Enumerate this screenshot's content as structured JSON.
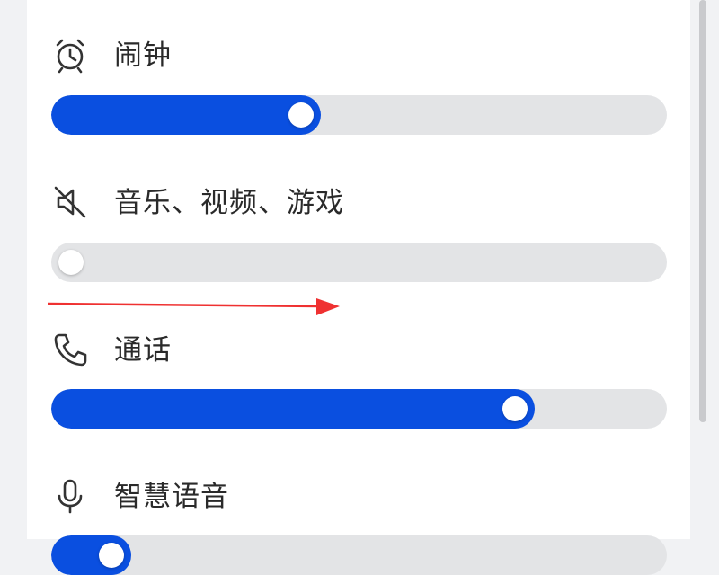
{
  "colors": {
    "accent": "#0a4fe0",
    "track": "#e3e4e6",
    "annotation_arrow": "#ef3131"
  },
  "volume_rows": [
    {
      "icon": "alarm-clock-icon",
      "label": "闹钟",
      "level": 0.4
    },
    {
      "icon": "speaker-muted-icon",
      "label": "音乐、视频、游戏",
      "level": 0.0
    },
    {
      "icon": "phone-icon",
      "label": "通话",
      "level": 0.77
    },
    {
      "icon": "microphone-icon",
      "label": "智慧语音",
      "level": 0.07
    }
  ]
}
